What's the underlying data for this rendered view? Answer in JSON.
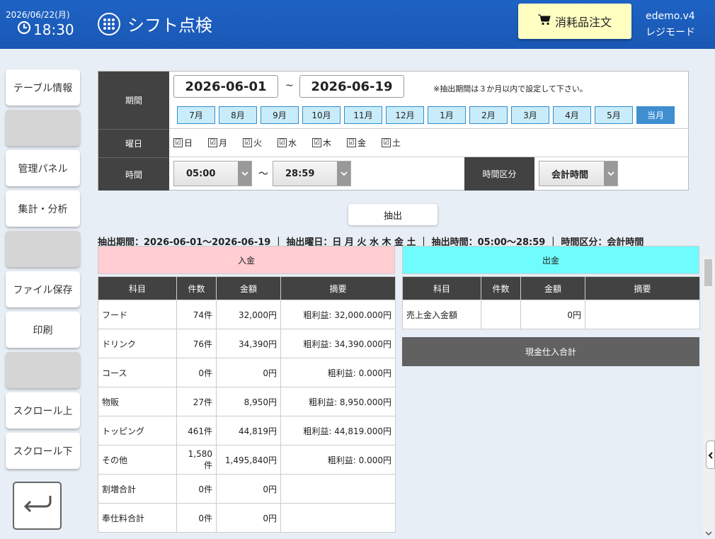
{
  "header": {
    "date": "2026/06/22(月)",
    "time": "18:30",
    "title": "シフト点検",
    "order_button": "消耗品注文",
    "user": "edemo.v4",
    "mode": "レジモード"
  },
  "sidebar": {
    "items": [
      "テーブル情報",
      "",
      "管理パネル",
      "集計・分析",
      "",
      "ファイル保存",
      "印刷",
      "",
      "スクロール上",
      "スクロール下"
    ]
  },
  "filter": {
    "period_label": "期間",
    "date_from": "2026-06-01",
    "tilde": "~",
    "date_to": "2026-06-19",
    "note": "※抽出期間は３か月以内で設定して下さい。",
    "months": [
      "7月",
      "8月",
      "9月",
      "10月",
      "11月",
      "12月",
      "1月",
      "2月",
      "3月",
      "4月",
      "5月",
      "当月"
    ],
    "weekday_label": "曜日",
    "weekdays": [
      "日",
      "月",
      "火",
      "水",
      "木",
      "金",
      "土"
    ],
    "time_label": "時間",
    "time_from": "05:00",
    "time_to": "28:59",
    "time_tilde": "～",
    "time_division_label": "時間区分",
    "time_division_value": "会計時間",
    "check_mark": "☑"
  },
  "extract_button": "抽出",
  "summary": "抽出期間：2026-06-01～2026-06-19 ｜ 抽出曜日：日 月 火 水 木 金 土 ｜ 抽出時間：05:00～28:59 ｜ 時間区分：会計時間",
  "income": {
    "title": "入金",
    "headers": [
      "科目",
      "件数",
      "金額",
      "摘要"
    ],
    "rows": [
      [
        "フード",
        "74件",
        "32,000円",
        "粗利益: 32,000.000円"
      ],
      [
        "ドリンク",
        "76件",
        "34,390円",
        "粗利益: 34,390.000円"
      ],
      [
        "コース",
        "0件",
        "0円",
        "粗利益: 0.000円"
      ],
      [
        "物販",
        "27件",
        "8,950円",
        "粗利益: 8,950.000円"
      ],
      [
        "トッピング",
        "461件",
        "44,819円",
        "粗利益: 44,819.000円"
      ],
      [
        "その他",
        "1,580件",
        "1,495,840円",
        "粗利益: 0.000円"
      ],
      [
        "割増合計",
        "0件",
        "0円",
        ""
      ],
      [
        "奉仕料合計",
        "0件",
        "0円",
        ""
      ]
    ]
  },
  "expense": {
    "title": "出金",
    "headers": [
      "科目",
      "件数",
      "金額",
      "摘要"
    ],
    "rows": [
      [
        "売上金入金額",
        "",
        "0円",
        ""
      ]
    ],
    "cash_purchase_total": "現金仕入合計"
  },
  "colors": {
    "header_blue": "#1e63c4",
    "income_bg": "#ffcdd2",
    "expense_bg": "#6ffcfc",
    "current_month": "#3e8ed0"
  }
}
